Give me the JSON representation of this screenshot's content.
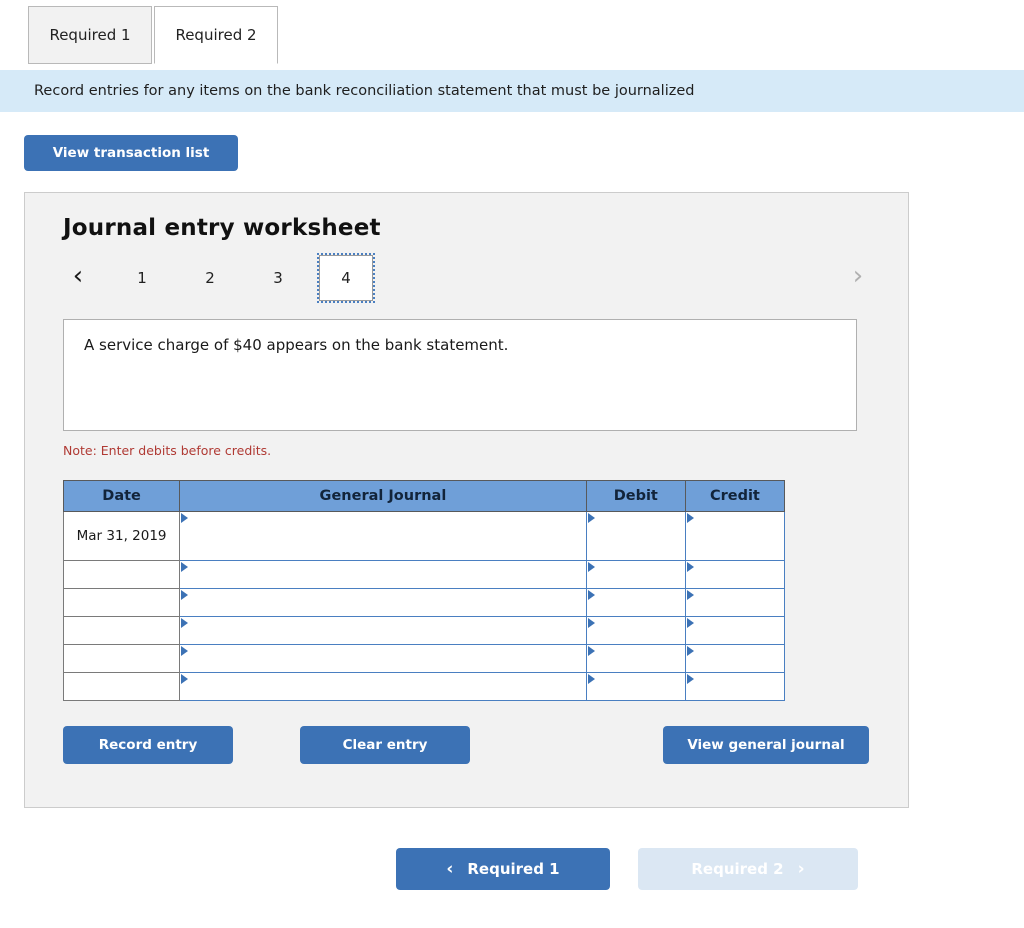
{
  "tabs": [
    {
      "label": "Required 1",
      "active": false
    },
    {
      "label": "Required 2",
      "active": true
    }
  ],
  "instruction": "Record entries for any items on the bank reconciliation statement that must be journalized",
  "toolbar": {
    "view_transaction_list_label": "View transaction list"
  },
  "worksheet": {
    "title": "Journal entry worksheet",
    "pager": {
      "prev_icon": "chevron-left-icon",
      "next_icon": "chevron-right-icon",
      "pages": [
        "1",
        "2",
        "3",
        "4"
      ],
      "current_page": "4"
    },
    "transaction_text": "A service charge of $40 appears on the bank statement.",
    "note": "Note: Enter debits before credits.",
    "table": {
      "headers": [
        "Date",
        "General Journal",
        "Debit",
        "Credit"
      ],
      "rows": [
        {
          "date": "Mar 31, 2019",
          "general_journal": "",
          "debit": "",
          "credit": ""
        },
        {
          "date": "",
          "general_journal": "",
          "debit": "",
          "credit": ""
        },
        {
          "date": "",
          "general_journal": "",
          "debit": "",
          "credit": ""
        },
        {
          "date": "",
          "general_journal": "",
          "debit": "",
          "credit": ""
        },
        {
          "date": "",
          "general_journal": "",
          "debit": "",
          "credit": ""
        },
        {
          "date": "",
          "general_journal": "",
          "debit": "",
          "credit": ""
        }
      ]
    },
    "actions": {
      "record_entry_label": "Record entry",
      "clear_entry_label": "Clear entry",
      "view_general_journal_label": "View general journal"
    }
  },
  "footer": {
    "prev_label": "Required 1",
    "prev_icon": "chevron-left-icon",
    "next_label": "Required 2",
    "next_icon": "chevron-right-icon",
    "next_disabled": true
  },
  "colors": {
    "accent_blue": "#3c72b5",
    "table_header_blue": "#6f9fd8",
    "instruction_bg": "#d6eaf8",
    "panel_bg": "#f2f2f2",
    "note_red": "#b03a34",
    "disabled_blue": "#dbe7f3"
  }
}
